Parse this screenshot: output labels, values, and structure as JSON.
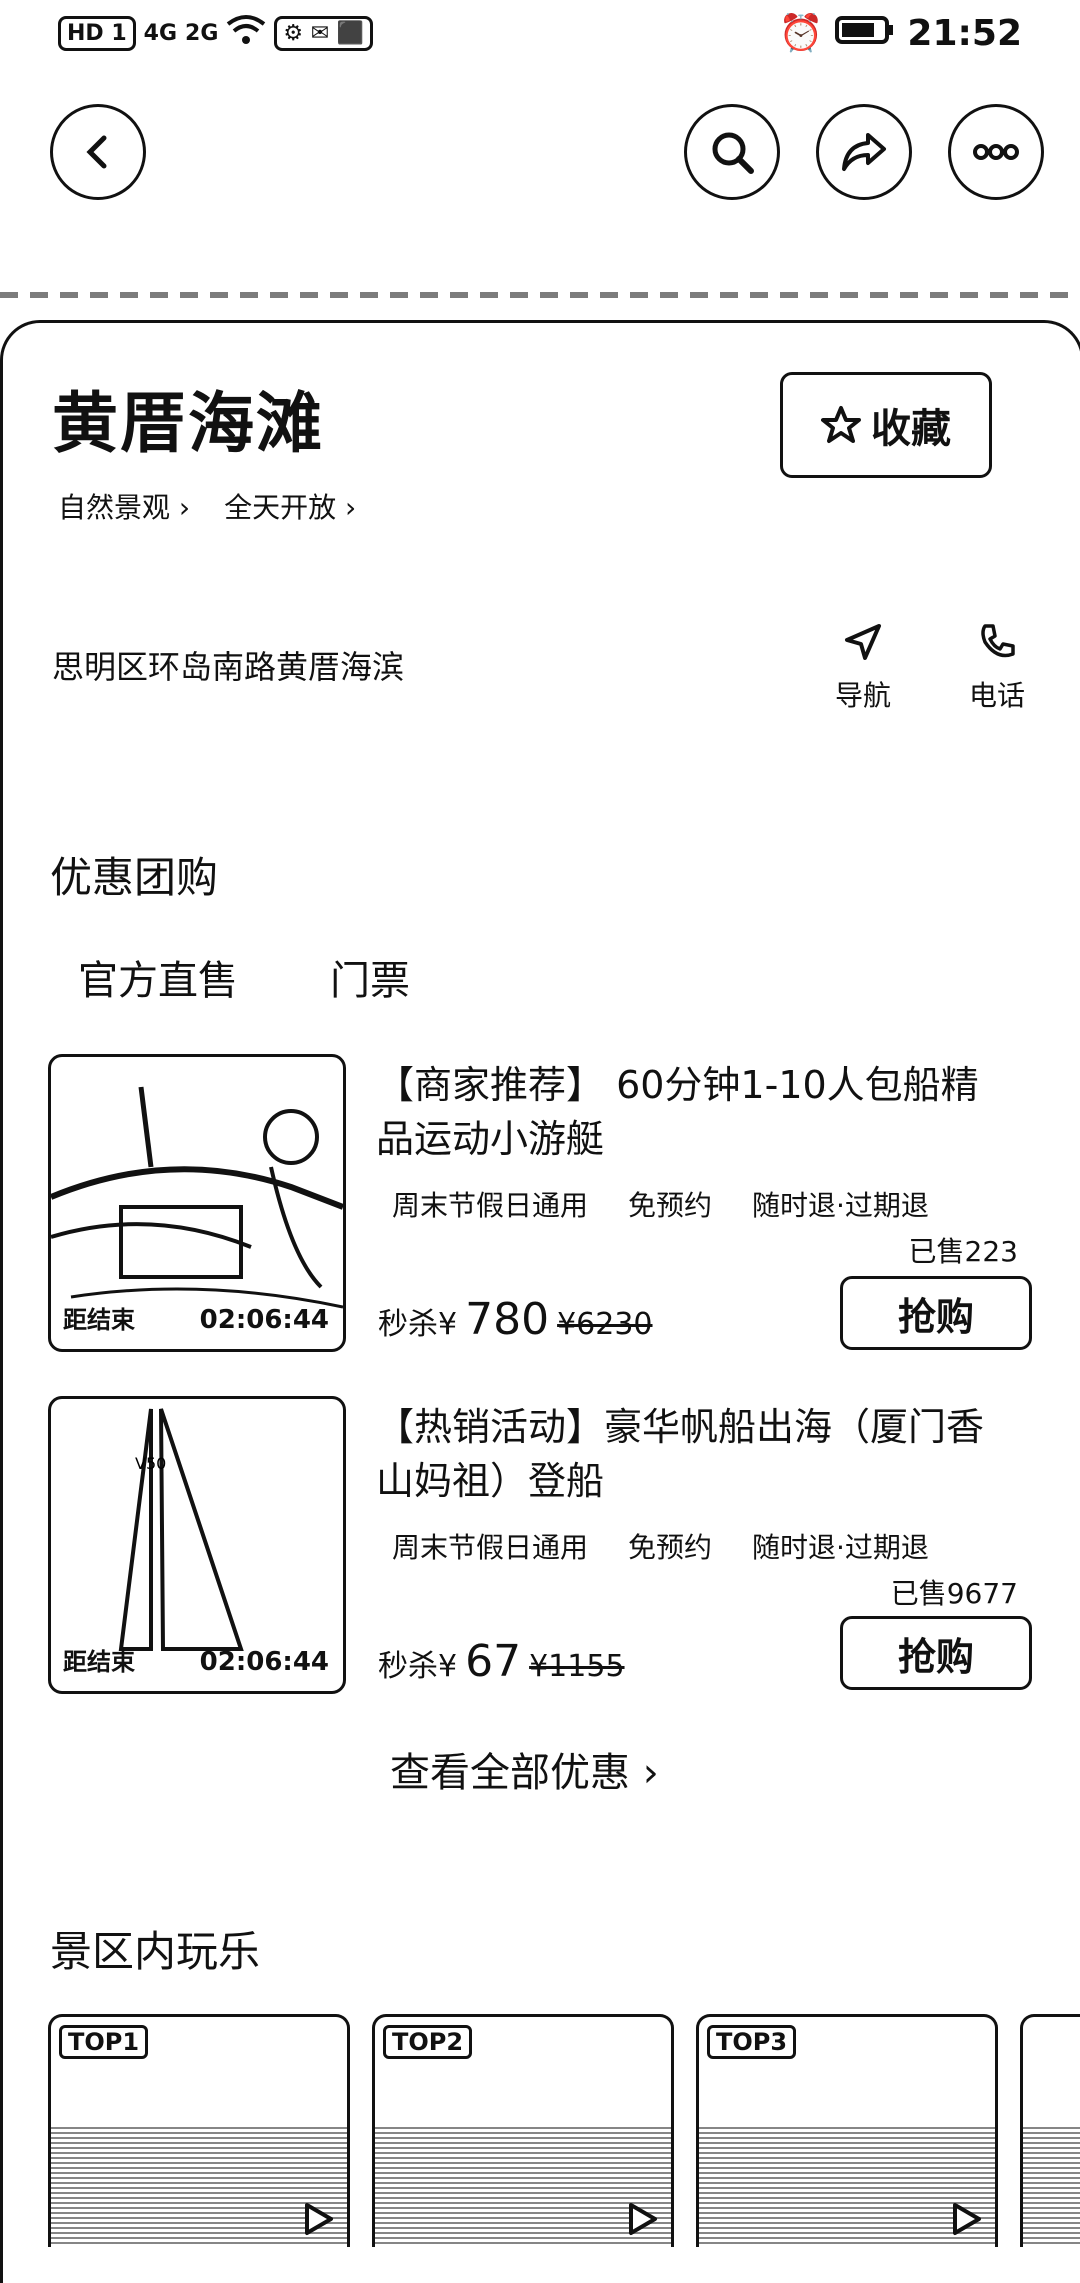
{
  "status_bar": {
    "left_icons": [
      "HD 1",
      "4G",
      "2G",
      "wifi",
      "app-icons"
    ],
    "time": "21:52"
  },
  "place": {
    "title": "黄厝海滩",
    "favorite_label": "收藏",
    "tags": [
      "自然景观",
      "全天开放"
    ],
    "address": "思明区环岛南路黄厝海滨"
  },
  "actions": {
    "navigate": "导航",
    "phone": "电话"
  },
  "deals_section": {
    "title": "优惠团购",
    "tabs": [
      "官方直售",
      "门票"
    ],
    "items": [
      {
        "title": "【商家推荐】 60分钟1-10人包船精品运动小游艇",
        "tags": [
          "周末节假日通用",
          "免预约",
          "随时退·过期退"
        ],
        "sold": "已售223",
        "price_prefix": "秒杀¥",
        "price": "780",
        "original_price": "¥6230",
        "countdown_label": "距结束",
        "countdown": "02:06:44",
        "buy_label": "抢购"
      },
      {
        "title": "【热销活动】豪华帆船出海（厦门香山妈祖）登船",
        "tags": [
          "周末节假日通用",
          "免预约",
          "随时退·过期退"
        ],
        "sold": "已售9677",
        "price_prefix": "秒杀¥",
        "price": "67",
        "original_price": "¥1155",
        "countdown_label": "距结束",
        "countdown": "02:06:44",
        "buy_label": "抢购"
      }
    ],
    "view_all": "查看全部优惠 ›"
  },
  "play_section": {
    "title": "景区内玩乐",
    "cards": [
      {
        "badge": "TOP1"
      },
      {
        "badge": "TOP2"
      },
      {
        "badge": "TOP3"
      }
    ]
  }
}
